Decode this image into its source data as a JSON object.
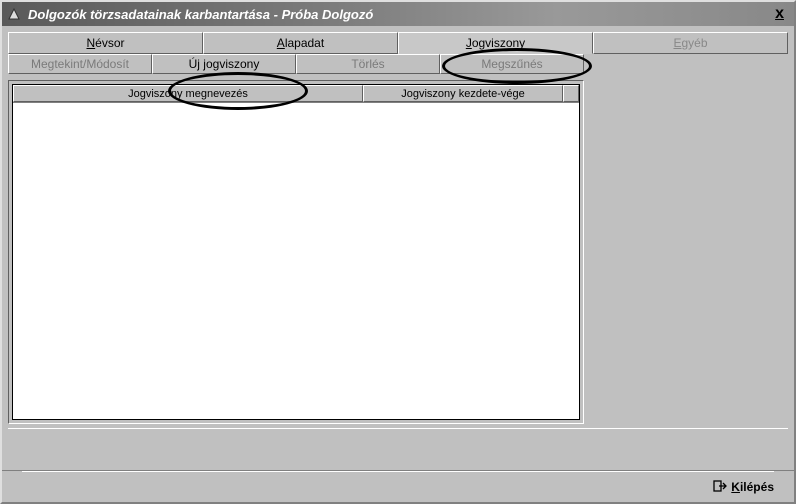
{
  "window": {
    "title": "Dolgozók törzsadatainak karbantartása - Próba Dolgozó",
    "close_symbol": "x"
  },
  "tabs": {
    "main": [
      {
        "label": "Névsor",
        "underline_char": "N"
      },
      {
        "label": "Alapadat",
        "underline_char": "A"
      },
      {
        "label": "Jogviszony",
        "underline_char": "J"
      },
      {
        "label": "Egyéb",
        "underline_char": "E"
      }
    ],
    "sub": [
      {
        "label": "Megtekint/Módosít"
      },
      {
        "label": "Új jogviszony"
      },
      {
        "label": "Törlés"
      },
      {
        "label": "Megszűnés"
      }
    ]
  },
  "table": {
    "columns": [
      "Jogviszony megnevezés",
      "Jogviszony kezdete-vége"
    ]
  },
  "footer": {
    "exit_label": "Kilépés",
    "exit_underline": "K"
  }
}
